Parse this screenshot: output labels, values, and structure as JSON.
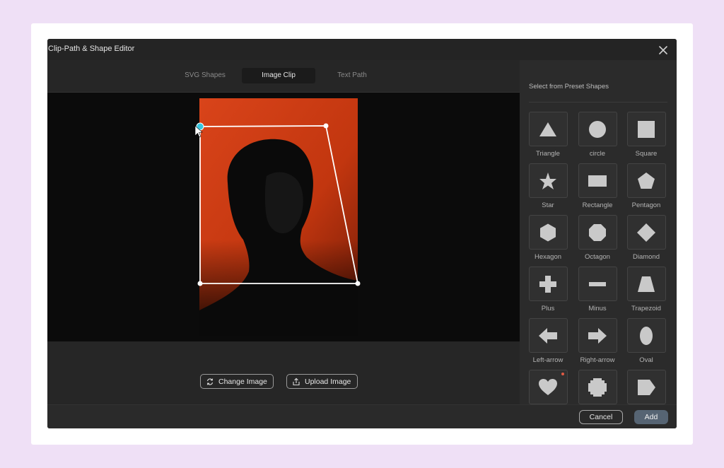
{
  "dialog": {
    "title": "Clip-Path & Shape Editor"
  },
  "tabs": [
    {
      "label": "SVG Shapes",
      "active": false
    },
    {
      "label": "Image Clip",
      "active": true
    },
    {
      "label": "Text Path",
      "active": false
    }
  ],
  "image_actions": {
    "change_label": "Change Image",
    "upload_label": "Upload Image"
  },
  "presets": {
    "header": "Select from Preset Shapes",
    "shapes": [
      {
        "label": "Triangle",
        "icon": "triangle-icon"
      },
      {
        "label": "circle",
        "icon": "circle-icon"
      },
      {
        "label": "Square",
        "icon": "square-icon"
      },
      {
        "label": "Star",
        "icon": "star-icon"
      },
      {
        "label": "Rectangle",
        "icon": "rectangle-icon"
      },
      {
        "label": "Pentagon",
        "icon": "pentagon-icon"
      },
      {
        "label": "Hexagon",
        "icon": "hexagon-icon"
      },
      {
        "label": "Octagon",
        "icon": "octagon-icon"
      },
      {
        "label": "Diamond",
        "icon": "diamond-icon"
      },
      {
        "label": "Plus",
        "icon": "plus-icon"
      },
      {
        "label": "Minus",
        "icon": "minus-icon"
      },
      {
        "label": "Trapezoid",
        "icon": "trapezoid-icon"
      },
      {
        "label": "Left-arrow",
        "icon": "left-arrow-icon"
      },
      {
        "label": "Right-arrow",
        "icon": "right-arrow-icon"
      },
      {
        "label": "Oval",
        "icon": "oval-icon"
      },
      {
        "label": "",
        "icon": "heart-icon"
      },
      {
        "label": "",
        "icon": "rounded-octagon-icon"
      },
      {
        "label": "",
        "icon": "tag-icon"
      }
    ]
  },
  "footer": {
    "cancel_label": "Cancel",
    "add_label": "Add"
  },
  "colors": {
    "accent_handle": "#37c6e0",
    "photo_background": "#c83a14",
    "add_button": "#566473"
  }
}
